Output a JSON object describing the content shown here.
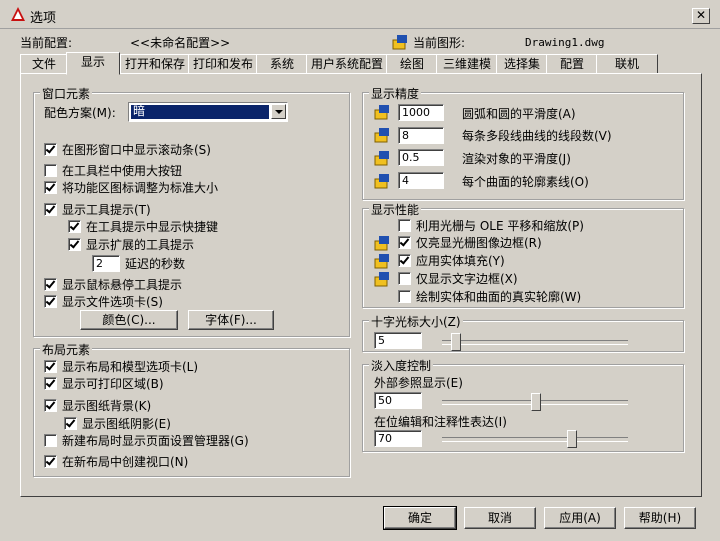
{
  "window": {
    "title": "选项"
  },
  "header": {
    "profile_label": "当前配置:",
    "profile_value": "<<未命名配置>>",
    "drawing_label": "当前图形:",
    "drawing_value": "Drawing1.dwg"
  },
  "tabs": [
    "文件",
    "显示",
    "打开和保存",
    "打印和发布",
    "系统",
    "用户系统配置",
    "绘图",
    "三维建模",
    "选择集",
    "配置",
    "联机"
  ],
  "active_tab": "显示",
  "window_elements": {
    "title": "窗口元素",
    "color_scheme_label": "配色方案(M):",
    "color_scheme_value": "暗",
    "items": [
      {
        "label": "在图形窗口中显示滚动条(S)",
        "checked": true
      },
      {
        "label": "在工具栏中使用大按钮",
        "checked": false
      },
      {
        "label": "将功能区图标调整为标准大小",
        "checked": true
      },
      {
        "label": "显示工具提示(T)",
        "checked": true
      },
      {
        "label": "在工具提示中显示快捷键",
        "checked": true
      },
      {
        "label": "显示扩展的工具提示",
        "checked": true
      },
      {
        "label": "延迟的秒数",
        "value": "2"
      },
      {
        "label": "显示鼠标悬停工具提示",
        "checked": true
      },
      {
        "label": "显示文件选项卡(S)",
        "checked": true
      }
    ],
    "colors_button": "颜色(C)...",
    "fonts_button": "字体(F)..."
  },
  "layout_elements": {
    "title": "布局元素",
    "items": [
      {
        "label": "显示布局和模型选项卡(L)",
        "checked": true
      },
      {
        "label": "显示可打印区域(B)",
        "checked": true
      },
      {
        "label": "显示图纸背景(K)",
        "checked": true
      },
      {
        "label": "显示图纸阴影(E)",
        "checked": true
      },
      {
        "label": "新建布局时显示页面设置管理器(G)",
        "checked": false
      },
      {
        "label": "在新布局中创建视口(N)",
        "checked": true
      }
    ]
  },
  "display_resolution": {
    "title": "显示精度",
    "items": [
      {
        "value": "1000",
        "label": "圆弧和圆的平滑度(A)"
      },
      {
        "value": "8",
        "label": "每条多段线曲线的线段数(V)"
      },
      {
        "value": "0.5",
        "label": "渲染对象的平滑度(J)"
      },
      {
        "value": "4",
        "label": "每个曲面的轮廓素线(O)"
      }
    ]
  },
  "display_performance": {
    "title": "显示性能",
    "items": [
      {
        "label": "利用光栅与 OLE 平移和缩放(P)",
        "checked": false
      },
      {
        "label": "仅亮显光栅图像边框(R)",
        "checked": true
      },
      {
        "label": "应用实体填充(Y)",
        "checked": true
      },
      {
        "label": "仅显示文字边框(X)",
        "checked": false
      },
      {
        "label": "绘制实体和曲面的真实轮廓(W)",
        "checked": false
      }
    ]
  },
  "crosshair": {
    "title": "十字光标大小(Z)",
    "value": "5",
    "level": 5
  },
  "fade": {
    "title": "淡入度控制",
    "xref_label": "外部参照显示(E)",
    "xref_value": "50",
    "xref_level": 50,
    "inplace_label": "在位编辑和注释性表达(I)",
    "inplace_value": "70",
    "inplace_level": 70
  },
  "buttons": {
    "ok": "确定",
    "cancel": "取消",
    "apply": "应用(A)",
    "help": "帮助(H)"
  },
  "colors": {
    "accent": "#0a246a",
    "face": "#d4d0c8"
  }
}
